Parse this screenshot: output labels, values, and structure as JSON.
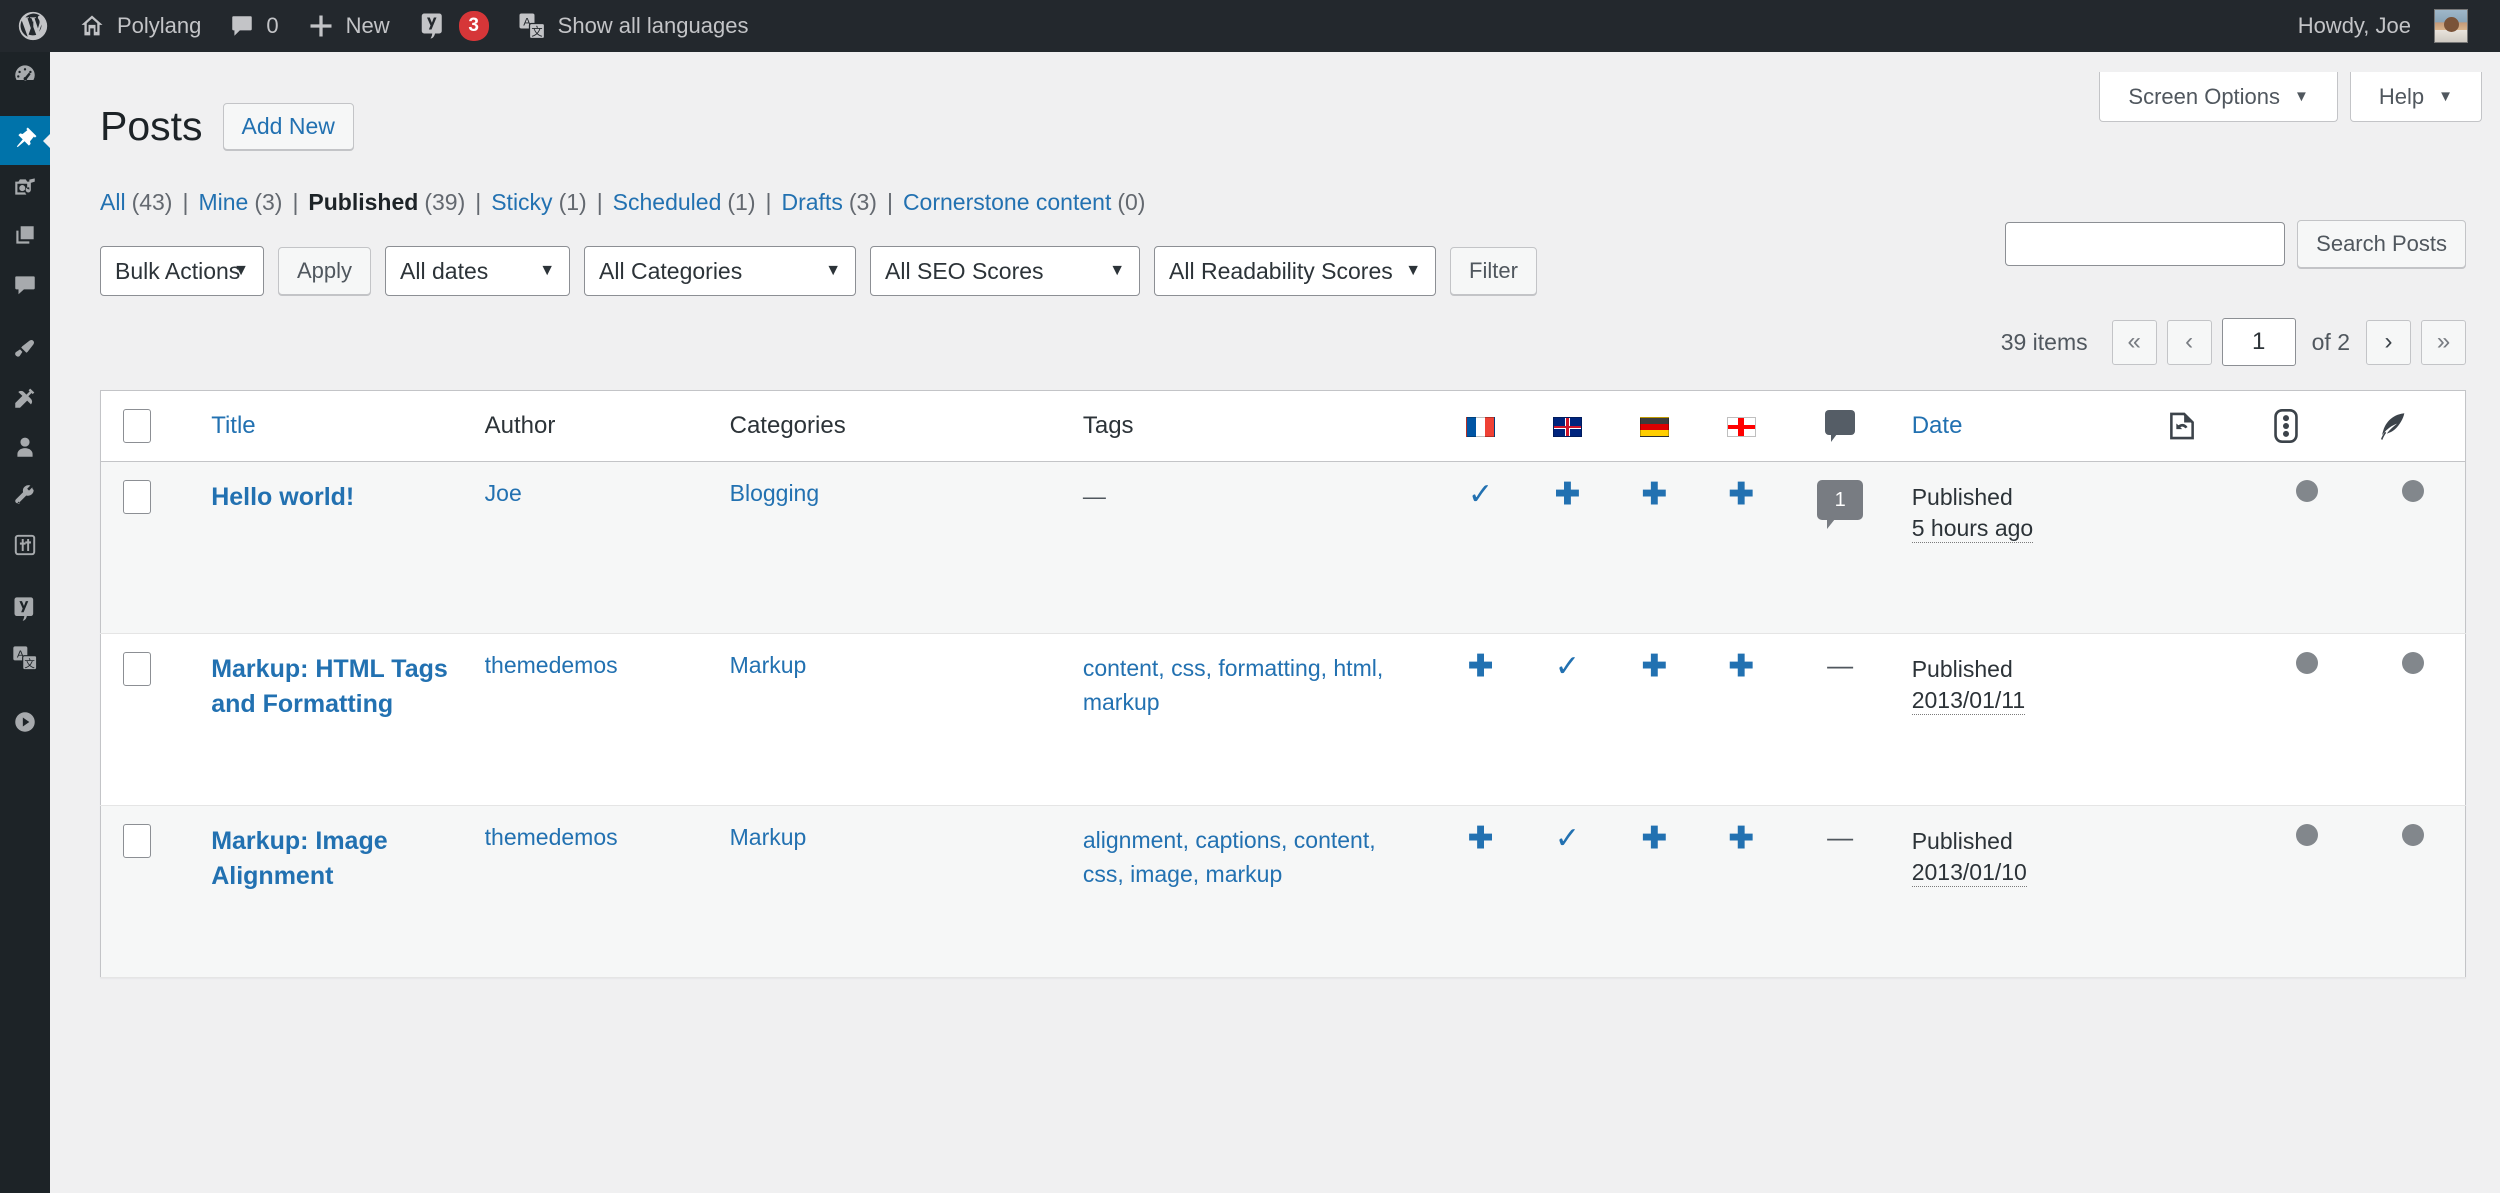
{
  "adminbar": {
    "logo": "wordpress-logo",
    "site_name": "Polylang",
    "comments_count": "0",
    "new_label": "New",
    "yoast_count": "3",
    "languages_label": "Show all languages",
    "howdy": "Howdy, Joe"
  },
  "sidebar": {
    "items": [
      {
        "name": "dashboard",
        "icon": "dashboard-icon",
        "active": false
      },
      {
        "name": "posts",
        "icon": "pin-icon",
        "active": true
      },
      {
        "name": "media",
        "icon": "media-icon",
        "active": false
      },
      {
        "name": "pages",
        "icon": "pages-icon",
        "active": false
      },
      {
        "name": "comments",
        "icon": "comment-icon",
        "active": false
      },
      {
        "name": "appearance",
        "icon": "paintbrush-icon",
        "active": false
      },
      {
        "name": "plugins",
        "icon": "plug-icon",
        "active": false
      },
      {
        "name": "users",
        "icon": "user-icon",
        "active": false
      },
      {
        "name": "tools",
        "icon": "wrench-icon",
        "active": false
      },
      {
        "name": "settings",
        "icon": "sliders-icon",
        "active": false
      },
      {
        "name": "yoast-seo",
        "icon": "yoast-icon",
        "active": false
      },
      {
        "name": "languages",
        "icon": "translate-icon",
        "active": false
      },
      {
        "name": "media-player",
        "icon": "play-icon",
        "active": false
      }
    ]
  },
  "screen_meta": {
    "screen_options": "Screen Options",
    "help": "Help",
    "caret": "▼"
  },
  "header": {
    "title": "Posts",
    "add_new": "Add New"
  },
  "views": [
    {
      "label": "All",
      "count": "(43)",
      "current": false
    },
    {
      "label": "Mine",
      "count": "(3)",
      "current": false
    },
    {
      "label": "Published",
      "count": "(39)",
      "current": true
    },
    {
      "label": "Sticky",
      "count": "(1)",
      "current": false
    },
    {
      "label": "Scheduled",
      "count": "(1)",
      "current": false
    },
    {
      "label": "Drafts",
      "count": "(3)",
      "current": false
    },
    {
      "label": "Cornerstone content",
      "count": "(0)",
      "current": false
    }
  ],
  "search": {
    "value": "",
    "placeholder": "",
    "button": "Search Posts"
  },
  "filters": {
    "bulk_actions": "Bulk Actions",
    "apply": "Apply",
    "all_dates": "All dates",
    "all_categories": "All Categories",
    "all_seo_scores": "All SEO Scores",
    "all_readability_scores": "All Readability Scores",
    "filter": "Filter",
    "arrow": "▼"
  },
  "pagination": {
    "items": "39 items",
    "first": "«",
    "prev": "‹",
    "current_page": "1",
    "of_total": "of 2",
    "next": "›",
    "last": "»"
  },
  "table": {
    "columns": {
      "title": "Title",
      "author": "Author",
      "categories": "Categories",
      "tags": "Tags",
      "lang_fr": "flag-france-icon",
      "lang_en": "flag-uk-icon",
      "lang_de": "flag-germany-icon",
      "lang_ka": "flag-georgia-icon",
      "comments": "comment-icon",
      "date": "Date",
      "yoast_readability_page": "yoast-page-icon",
      "yoast_seo_score": "yoast-traffic-light-icon",
      "yoast_readability": "yoast-feather-icon"
    },
    "rows": [
      {
        "title": "Hello world!",
        "author": "Joe",
        "categories": "Blogging",
        "tags": "—",
        "lang_fr": "check",
        "lang_en": "plus",
        "lang_de": "plus",
        "lang_ka": "plus",
        "comments": "1",
        "date_status": "Published",
        "date_value": "5 hours ago",
        "seo_score": "gray",
        "readability_score": "gray"
      },
      {
        "title": "Markup: HTML Tags and Formatting",
        "author": "themedemos",
        "categories": "Markup",
        "tags": "content, css, formatting, html, markup",
        "lang_fr": "plus",
        "lang_en": "check",
        "lang_de": "plus",
        "lang_ka": "plus",
        "comments": "—",
        "date_status": "Published",
        "date_value": "2013/01/11",
        "seo_score": "gray",
        "readability_score": "gray"
      },
      {
        "title": "Markup: Image Alignment",
        "author": "themedemos",
        "categories": "Markup",
        "tags": "alignment, captions, content, css, image, markup",
        "lang_fr": "plus",
        "lang_en": "check",
        "lang_de": "plus",
        "lang_ka": "plus",
        "comments": "—",
        "date_status": "Published",
        "date_value": "2013/01/10",
        "seo_score": "gray",
        "readability_score": "gray"
      }
    ]
  },
  "colors": {
    "adminbar_bg": "#23282d",
    "menu_bg": "#1d2327",
    "menu_active": "#0073aa",
    "link": "#2271b1",
    "badge_red": "#d63638",
    "page_bg": "#f0f0f1",
    "score_gray": "#82878c"
  }
}
